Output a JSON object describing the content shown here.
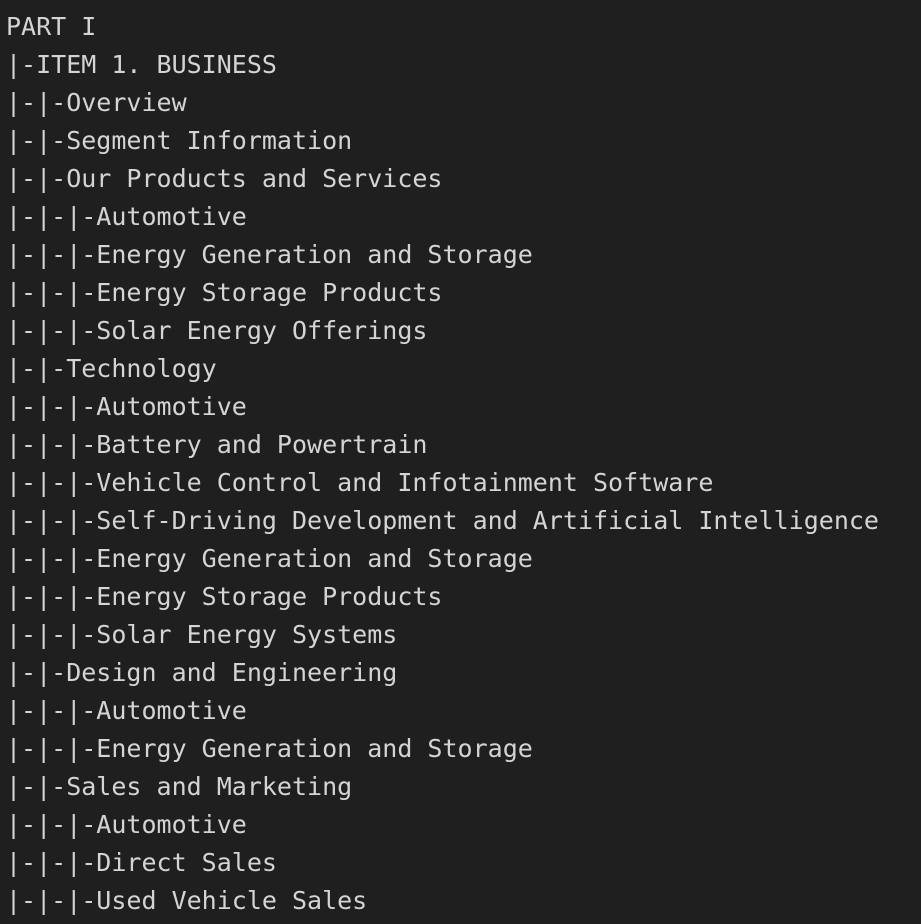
{
  "outline": {
    "lines": [
      "PART I",
      "|-ITEM 1. BUSINESS",
      "|-|-Overview",
      "|-|-Segment Information",
      "|-|-Our Products and Services",
      "|-|-|-Automotive",
      "|-|-|-Energy Generation and Storage",
      "|-|-|-Energy Storage Products",
      "|-|-|-Solar Energy Offerings",
      "|-|-Technology",
      "|-|-|-Automotive",
      "|-|-|-Battery and Powertrain",
      "|-|-|-Vehicle Control and Infotainment Software",
      "|-|-|-Self-Driving Development and Artificial Intelligence",
      "|-|-|-Energy Generation and Storage",
      "|-|-|-Energy Storage Products",
      "|-|-|-Solar Energy Systems",
      "|-|-Design and Engineering",
      "|-|-|-Automotive",
      "|-|-|-Energy Generation and Storage",
      "|-|-Sales and Marketing",
      "|-|-|-Automotive",
      "|-|-|-Direct Sales",
      "|-|-|-Used Vehicle Sales"
    ]
  }
}
